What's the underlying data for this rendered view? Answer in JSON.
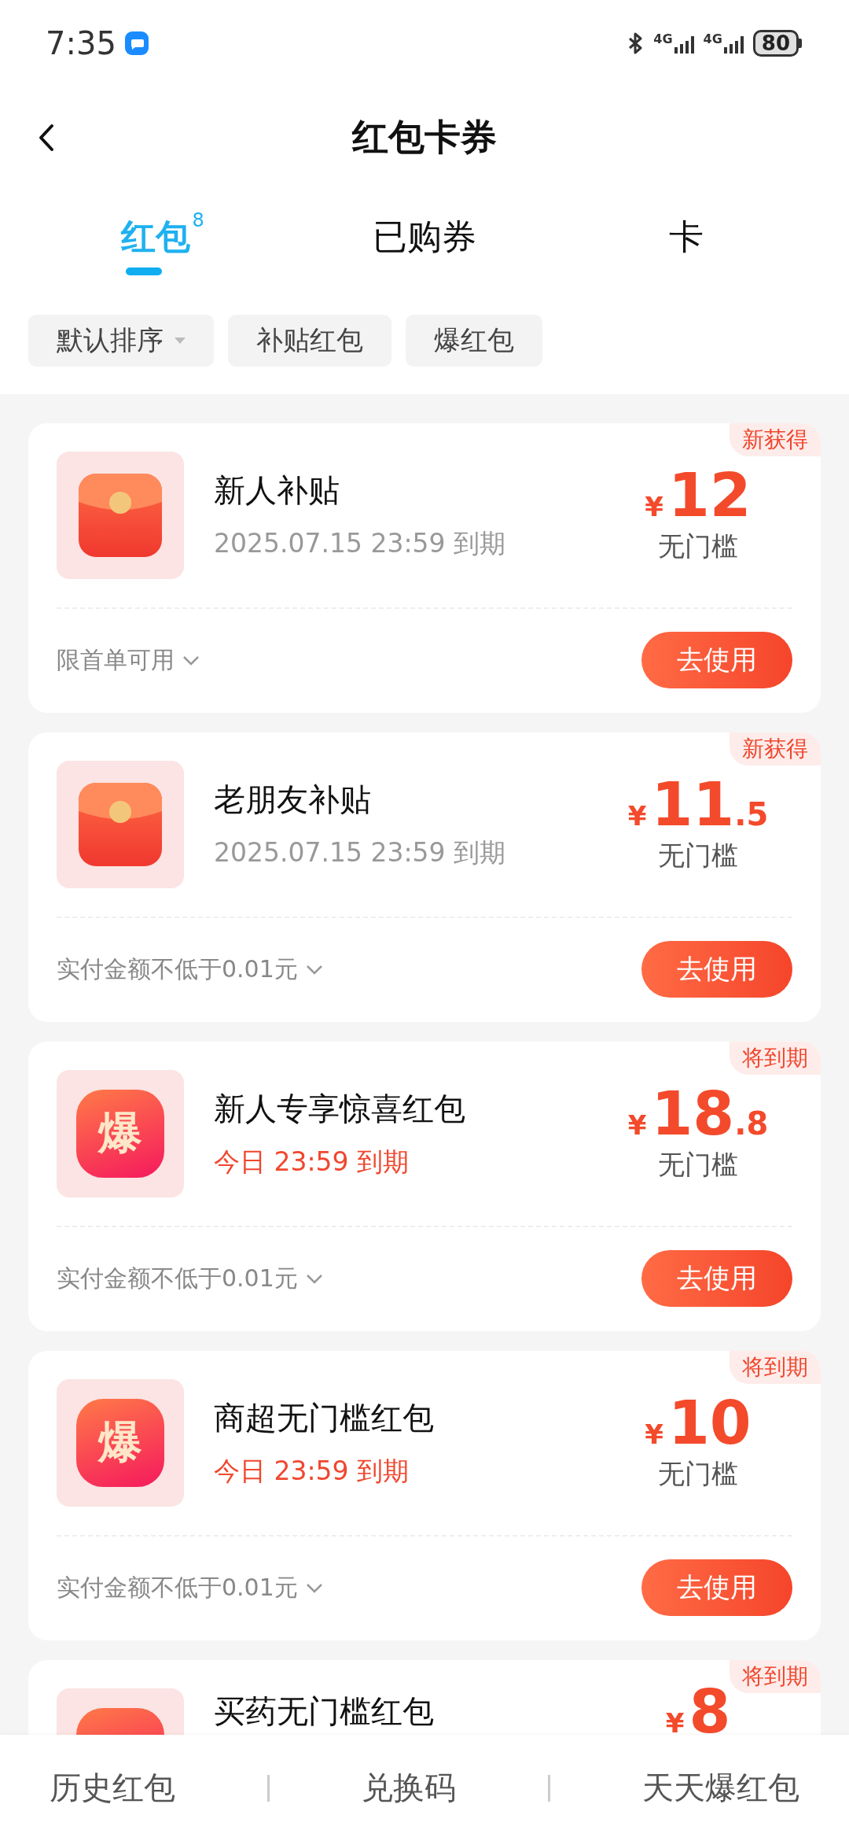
{
  "status_bar": {
    "time": "7:35",
    "signals": [
      {
        "label": "4G"
      },
      {
        "label": "4G"
      }
    ],
    "battery": "80"
  },
  "header": {
    "title": "红包卡券"
  },
  "tabs": [
    {
      "label": "红包",
      "count": "8",
      "selected": true
    },
    {
      "label": "已购券",
      "selected": false
    },
    {
      "label": "卡",
      "selected": false
    }
  ],
  "filters": [
    {
      "label": "默认排序",
      "dropdown": true
    },
    {
      "label": "补贴红包",
      "dropdown": false
    },
    {
      "label": "爆红包",
      "dropdown": false
    }
  ],
  "coupons": [
    {
      "badge": "新获得",
      "kind": "envelope",
      "title": "新人补贴",
      "expiry": "2025.07.15 23:59 到期",
      "urgent": false,
      "currency": "¥",
      "amount": "12",
      "threshold": "无门槛",
      "condition": "限首单可用",
      "action": "去使用"
    },
    {
      "badge": "新获得",
      "kind": "envelope",
      "title": "老朋友补贴",
      "expiry": "2025.07.15 23:59 到期",
      "urgent": false,
      "currency": "¥",
      "amount": "11",
      "decimal": ".5",
      "threshold": "无门槛",
      "condition": "实付金额不低于0.01元",
      "action": "去使用"
    },
    {
      "badge": "将到期",
      "kind": "bao",
      "icon_text": "爆",
      "title": "新人专享惊喜红包",
      "expiry": "今日 23:59 到期",
      "urgent": true,
      "currency": "¥",
      "amount": "18",
      "decimal": ".8",
      "threshold": "无门槛",
      "condition": "实付金额不低于0.01元",
      "action": "去使用"
    },
    {
      "badge": "将到期",
      "kind": "bao",
      "icon_text": "爆",
      "title": "商超无门槛红包",
      "expiry": "今日 23:59 到期",
      "urgent": true,
      "currency": "¥",
      "amount": "10",
      "threshold": "无门槛",
      "condition": "实付金额不低于0.01元",
      "action": "去使用"
    },
    {
      "badge": "将到期",
      "kind": "bao",
      "title": "买药无门槛红包",
      "currency": "¥",
      "amount": "8"
    }
  ],
  "bottom_bar": [
    {
      "label": "历史红包"
    },
    {
      "label": "兑换码"
    },
    {
      "label": "天天爆红包"
    }
  ]
}
